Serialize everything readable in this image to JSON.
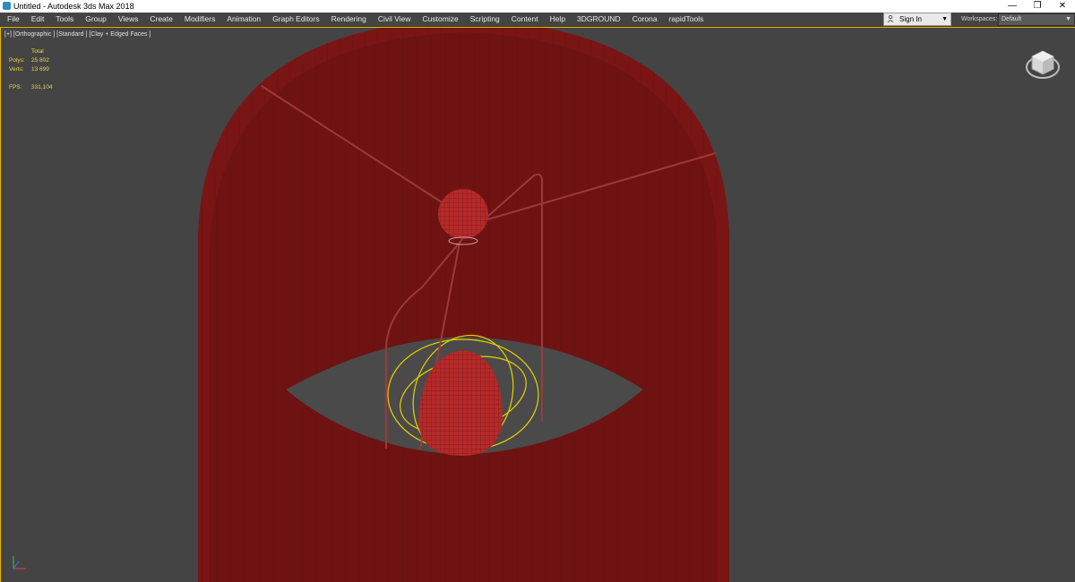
{
  "window": {
    "title": "Untitled - Autodesk 3ds Max 2018",
    "controls": [
      "—",
      "❐",
      "✕"
    ]
  },
  "menu": {
    "items": [
      "File",
      "Edit",
      "Tools",
      "Group",
      "Views",
      "Create",
      "Modifiers",
      "Animation",
      "Graph Editors",
      "Rendering",
      "Civil View",
      "Customize",
      "Scripting",
      "Content",
      "Help",
      "3DGROUND",
      "Corona",
      "rapidTools"
    ]
  },
  "signin": {
    "label": "Sign In"
  },
  "workspaces": {
    "label": "Workspaces:",
    "value": "Default"
  },
  "viewport": {
    "label": "[+] [Orthographic ] [Standard ] [Clay + Edged Faces ]",
    "stats": {
      "header": "Total",
      "polys_label": "Polys:",
      "polys_value": "25 802",
      "verts_label": "Verts:",
      "verts_value": "13 699",
      "fps_label": "FPS:",
      "fps_value": "331,104"
    }
  },
  "colors": {
    "viewport_bg": "#444444",
    "lampshade": "#7a1515",
    "lampshade_inner": "#6a1010",
    "active_border": "#e6b400",
    "light_helper": "#e8d000",
    "stats_text": "#e8d64a"
  },
  "icons": [
    "app-icon",
    "user-icon",
    "viewcube-icon",
    "axis-tripod-icon"
  ]
}
